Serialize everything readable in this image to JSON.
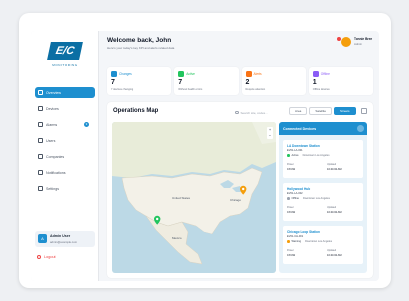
{
  "brand": {
    "logo_text": "E/C",
    "logo_sub": "MONITORING"
  },
  "header": {
    "welcome": "Welcome back, John",
    "subtitle": "Here's your today's key KPI and alerts related data",
    "user_name": "Tonnie Bree",
    "user_role": "Admin"
  },
  "sidebar": {
    "items": [
      {
        "label": "Overview",
        "active": true
      },
      {
        "label": "Devices"
      },
      {
        "label": "Alarms",
        "badge": "3"
      },
      {
        "label": "Users"
      },
      {
        "label": "Companies"
      },
      {
        "label": "Notifications"
      },
      {
        "label": "Settings"
      }
    ],
    "user_card": {
      "name": "Admin User",
      "email": "admin@example.com",
      "initial": "A"
    },
    "logout": "Logout"
  },
  "stats": [
    {
      "label": "Changes",
      "value": "7",
      "sub": "7 devices changing",
      "color": "#1e8fcf"
    },
    {
      "label": "Active",
      "value": "7",
      "sub": "Without health errors",
      "color": "#22c55e"
    },
    {
      "label": "Alerts",
      "value": "2",
      "sub": "Require attention",
      "color": "#f97316"
    },
    {
      "label": "Offline",
      "value": "1",
      "sub": "Offline devices",
      "color": "#8b5cf6"
    }
  ],
  "operations": {
    "title": "Operations Map",
    "search_placeholder": "Search site, codes...",
    "filters": [
      "Area",
      "Satellite",
      "Streets"
    ],
    "active_filter": "Streets",
    "map_labels": {
      "country": "United States",
      "city1": "Chicago",
      "city2": "Mexico"
    }
  },
  "devices_panel": {
    "title": "Connected Devices",
    "devices": [
      {
        "name": "LA Downtown Station",
        "id": "EV01-LA-001",
        "status": "Active",
        "status_color": "#22c55e",
        "location": "Downtown Los Angeles",
        "k1": "Power",
        "v1": "0.8 kW",
        "k2": "Updated",
        "v2": "10:44:02 AM"
      },
      {
        "name": "Hollywood Hub",
        "id": "EV01-LA-002",
        "status": "Offline",
        "status_color": "#9ca3af",
        "location": "Downtown Los Angeles",
        "k1": "Power",
        "v1": "0.8 kW",
        "k2": "Updated",
        "v2": "10:44:02 AM"
      },
      {
        "name": "Chicago Loop Station",
        "id": "EV01-CH-001",
        "status": "Warning",
        "status_color": "#f59e0b",
        "location": "Downtown Los Angeles",
        "k1": "Power",
        "v1": "0.8 kW",
        "k2": "Updated",
        "v2": "10:44:02 AM"
      }
    ]
  }
}
